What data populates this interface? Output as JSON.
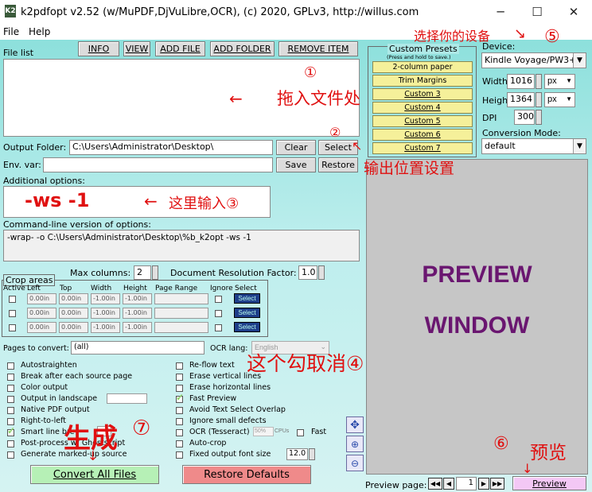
{
  "window": {
    "title": "k2pdfopt v2.52 (w/MuPDF,DjVuLibre,OCR), (c) 2020, GPLv3, http://willus.com",
    "icon": "K2",
    "min": "─",
    "max": "☐",
    "close": "✕"
  },
  "menu": {
    "file": "File",
    "help": "Help"
  },
  "toolbar": {
    "file_list": "File list",
    "info": "INFO",
    "view": "VIEW",
    "add_file": "ADD FILE",
    "add_folder": "ADD FOLDER",
    "remove_item": "REMOVE ITEM"
  },
  "output": {
    "folder_label": "Output Folder:",
    "folder_value": "C:\\Users\\Administrator\\Desktop\\",
    "clear": "Clear",
    "select": "Select",
    "env_label": "Env. var:",
    "save": "Save",
    "restore": "Restore"
  },
  "options": {
    "additional_label": "Additional options:",
    "additional_value": "-ws -1",
    "cmdline_label": "Command-line version of options:",
    "cmdline_value": "-wrap- -o C:\\Users\\Administrator\\Desktop\\%b_k2opt -ws -1"
  },
  "maxcols": {
    "label": "Max columns:",
    "value": "2"
  },
  "docres": {
    "label": "Document Resolution Factor:",
    "value": "1.0"
  },
  "crop": {
    "title": "Crop areas",
    "headers": [
      "Active",
      "Left",
      "Top",
      "Width",
      "Height",
      "Page Range",
      "Ignore",
      "Select"
    ],
    "rows": [
      [
        "0.00in",
        "0.00in",
        "-1.00in",
        "-1.00in"
      ],
      [
        "0.00in",
        "0.00in",
        "-1.00in",
        "-1.00in"
      ],
      [
        "0.00in",
        "0.00in",
        "-1.00in",
        "-1.00in"
      ]
    ],
    "select": "Select"
  },
  "pages": {
    "label": "Pages to convert:",
    "value": "(all)"
  },
  "ocr": {
    "label": "OCR lang:",
    "value": "English"
  },
  "checks_left": [
    {
      "label": "Autostraighten",
      "checked": false
    },
    {
      "label": "Break after each source page",
      "checked": false
    },
    {
      "label": "Color output",
      "checked": false
    },
    {
      "label": "Output in landscape",
      "checked": false
    },
    {
      "label": "Native PDF output",
      "checked": false
    },
    {
      "label": "Right-to-left",
      "checked": false
    },
    {
      "label": "Smart line bre",
      "checked": true
    },
    {
      "label": "Post-process w/ Ghostscript",
      "checked": false
    },
    {
      "label": "Generate marked-up source",
      "checked": false
    }
  ],
  "checks_right": [
    {
      "label": "Re-flow text",
      "checked": false
    },
    {
      "label": "Erase vertical lines",
      "checked": false
    },
    {
      "label": "Erase horizontal lines",
      "checked": false
    },
    {
      "label": "Fast Preview",
      "checked": true
    },
    {
      "label": "Avoid Text Select Overlap",
      "checked": false
    },
    {
      "label": "Ignore small defects",
      "checked": false
    },
    {
      "label": "OCR (Tesseract)",
      "checked": false
    },
    {
      "label": "Auto-crop",
      "checked": false
    },
    {
      "label": "Fixed output font size",
      "checked": false
    }
  ],
  "ocr_extra": {
    "cpu_value": "50%",
    "cpu_label": "CPUs",
    "fast": "Fast",
    "font_size": "12.0"
  },
  "bottom": {
    "convert": "Convert All Files",
    "restore_defaults": "Restore Defaults",
    "preview_page_label": "Preview page:",
    "preview_page": "1",
    "preview": "Preview"
  },
  "presets": {
    "title": "Custom Presets",
    "subtitle": "(Press and hold to save.)",
    "items": [
      "2-column paper",
      "Trim Margins",
      "Custom 3",
      "Custom 4",
      "Custom 5",
      "Custom 6",
      "Custom 7"
    ]
  },
  "device": {
    "label": "Device:",
    "value": "Kindle Voyage/PW3+",
    "width_label": "Width",
    "width": "1016",
    "height_label": "Height",
    "height": "1364",
    "unit": "px",
    "dpi_label": "DPI",
    "dpi": "300",
    "mode_label": "Conversion Mode:",
    "mode": "default"
  },
  "preview_area": {
    "line1": "PREVIEW",
    "line2": "WINDOW"
  },
  "annotations": {
    "a1_num": "①",
    "a1": "拖入文件处",
    "a2_num": "②",
    "a2": "输出位置设置",
    "a3": "这里输入③",
    "a4": "这个勾取消④",
    "a5": "选择你的设备",
    "a5_num": "⑤",
    "a6_num": "⑥",
    "a6": "预览",
    "a7": "生成",
    "a7_num": "⑦"
  },
  "colors": {
    "preview_bg": "#c6c6c6",
    "preview_text": "#6a1670",
    "annotation": "#e01010",
    "convert_bg": "#b6f0b6",
    "restore_bg": "#ef8a8a",
    "preview_btn": "#f3c8f5",
    "preset_bg": "#f5f09a"
  }
}
